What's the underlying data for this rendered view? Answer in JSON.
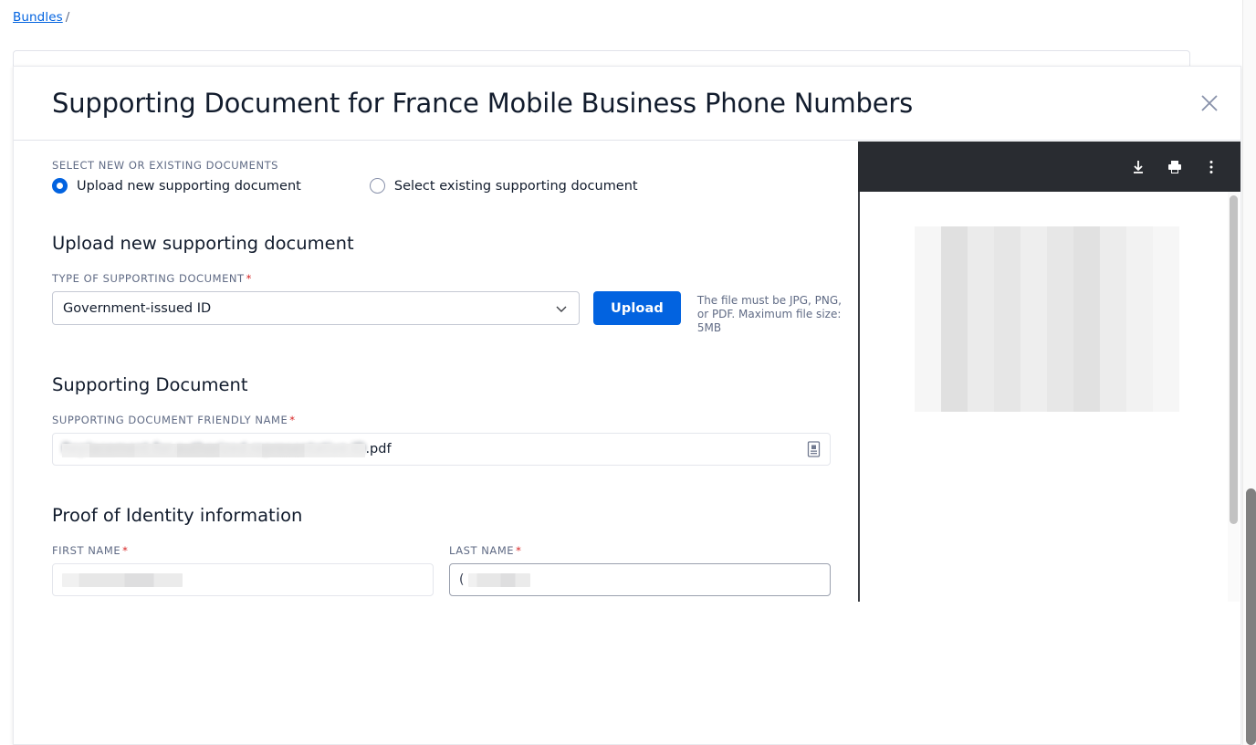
{
  "breadcrumb": {
    "root_label": "Bundles",
    "separator": "/"
  },
  "modal": {
    "title": "Supporting Document for France Mobile Business Phone Numbers",
    "close_icon": "close-icon"
  },
  "select_source": {
    "label": "SELECT NEW OR EXISTING DOCUMENTS",
    "options": [
      {
        "label": "Upload new supporting document",
        "selected": true
      },
      {
        "label": "Select existing supporting document",
        "selected": false
      }
    ]
  },
  "upload_section": {
    "heading": "Upload new supporting document",
    "type_label": "TYPE OF SUPPORTING DOCUMENT",
    "type_required_mark": "*",
    "type_value": "Government-issued ID",
    "chevron_icon": "chevron-down-icon",
    "upload_button": "Upload",
    "help_text": "The file must be JPG, PNG, or PDF. Maximum file size: 5MB"
  },
  "document_section": {
    "heading": "Supporting Document",
    "friendly_name_label": "SUPPORTING DOCUMENT FRIENDLY NAME",
    "friendly_name_required_mark": "*",
    "friendly_name_redacted_text": "Replacement for authorized representative ID",
    "friendly_name_suffix": ".pdf",
    "field_icon": "document-icon"
  },
  "identity_section": {
    "heading": "Proof of Identity information",
    "first_name_label": "FIRST NAME",
    "first_name_required_mark": "*",
    "first_name_value": "",
    "last_name_label": "LAST NAME",
    "last_name_required_mark": "*",
    "last_name_value": "("
  },
  "pdf_viewer": {
    "toolbar_icons": [
      "download-icon",
      "print-icon",
      "more-options-icon"
    ]
  },
  "colors": {
    "accent_blue": "#0263e0",
    "link_blue": "#0263e0",
    "required_red": "#d61f1f",
    "text_primary": "#121c2d",
    "text_muted": "#606b85",
    "toolbar_dark": "#292c31"
  }
}
